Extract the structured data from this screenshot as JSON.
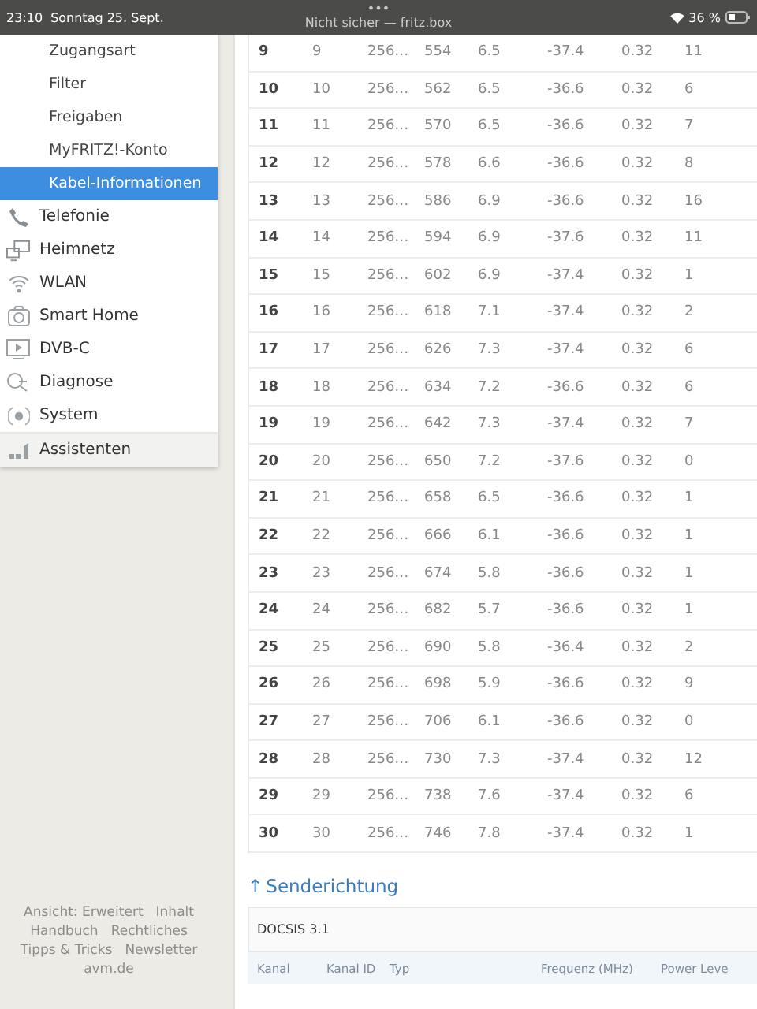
{
  "status_bar": {
    "time": "23:10",
    "date": "Sonntag 25. Sept.",
    "dots": "•••",
    "address": "Nicht sicher — fritz.box",
    "battery": "36 %"
  },
  "sidebar": {
    "items": [
      {
        "label": "Zugangsart",
        "kind": "sub",
        "selected": false
      },
      {
        "label": "Filter",
        "kind": "sub",
        "selected": false
      },
      {
        "label": "Freigaben",
        "kind": "sub",
        "selected": false
      },
      {
        "label": "MyFRITZ!-Konto",
        "kind": "sub",
        "selected": false
      },
      {
        "label": "Kabel-Informationen",
        "kind": "sub",
        "selected": true
      },
      {
        "label": "Telefonie",
        "kind": "main",
        "selected": false
      },
      {
        "label": "Heimnetz",
        "kind": "main",
        "selected": false
      },
      {
        "label": "WLAN",
        "kind": "main",
        "selected": false
      },
      {
        "label": "Smart Home",
        "kind": "main",
        "selected": false
      },
      {
        "label": "DVB-C",
        "kind": "main",
        "selected": false
      },
      {
        "label": "Diagnose",
        "kind": "main",
        "selected": false
      },
      {
        "label": "System",
        "kind": "main",
        "selected": false
      },
      {
        "label": "Assistenten",
        "kind": "assistant",
        "selected": false
      }
    ]
  },
  "footer_links": [
    [
      "Ansicht: Erweitert",
      "Inhalt"
    ],
    [
      "Handbuch",
      "Rechtliches"
    ],
    [
      "Tipps & Tricks",
      "Newsletter"
    ],
    [
      "avm.de"
    ]
  ],
  "table": {
    "rows": [
      [
        "9",
        "9",
        "256…",
        "554",
        "6.5",
        "-37.4",
        "0.32",
        "11"
      ],
      [
        "10",
        "10",
        "256…",
        "562",
        "6.5",
        "-36.6",
        "0.32",
        "6"
      ],
      [
        "11",
        "11",
        "256…",
        "570",
        "6.5",
        "-36.6",
        "0.32",
        "7"
      ],
      [
        "12",
        "12",
        "256…",
        "578",
        "6.6",
        "-36.6",
        "0.32",
        "8"
      ],
      [
        "13",
        "13",
        "256…",
        "586",
        "6.9",
        "-36.6",
        "0.32",
        "16"
      ],
      [
        "14",
        "14",
        "256…",
        "594",
        "6.9",
        "-37.6",
        "0.32",
        "11"
      ],
      [
        "15",
        "15",
        "256…",
        "602",
        "6.9",
        "-37.4",
        "0.32",
        "1"
      ],
      [
        "16",
        "16",
        "256…",
        "618",
        "7.1",
        "-37.4",
        "0.32",
        "2"
      ],
      [
        "17",
        "17",
        "256…",
        "626",
        "7.3",
        "-37.4",
        "0.32",
        "6"
      ],
      [
        "18",
        "18",
        "256…",
        "634",
        "7.2",
        "-36.6",
        "0.32",
        "6"
      ],
      [
        "19",
        "19",
        "256…",
        "642",
        "7.3",
        "-37.4",
        "0.32",
        "7"
      ],
      [
        "20",
        "20",
        "256…",
        "650",
        "7.2",
        "-37.6",
        "0.32",
        "0"
      ],
      [
        "21",
        "21",
        "256…",
        "658",
        "6.5",
        "-36.6",
        "0.32",
        "1"
      ],
      [
        "22",
        "22",
        "256…",
        "666",
        "6.1",
        "-36.6",
        "0.32",
        "1"
      ],
      [
        "23",
        "23",
        "256…",
        "674",
        "5.8",
        "-36.6",
        "0.32",
        "1"
      ],
      [
        "24",
        "24",
        "256…",
        "682",
        "5.7",
        "-36.6",
        "0.32",
        "1"
      ],
      [
        "25",
        "25",
        "256…",
        "690",
        "5.8",
        "-36.4",
        "0.32",
        "2"
      ],
      [
        "26",
        "26",
        "256…",
        "698",
        "5.9",
        "-36.6",
        "0.32",
        "9"
      ],
      [
        "27",
        "27",
        "256…",
        "706",
        "6.1",
        "-36.6",
        "0.32",
        "0"
      ],
      [
        "28",
        "28",
        "256…",
        "730",
        "7.3",
        "-37.4",
        "0.32",
        "12"
      ],
      [
        "29",
        "29",
        "256…",
        "738",
        "7.6",
        "-37.4",
        "0.32",
        "6"
      ],
      [
        "30",
        "30",
        "256…",
        "746",
        "7.8",
        "-37.4",
        "0.32",
        "1"
      ]
    ]
  },
  "upstream": {
    "arrow": "↑",
    "title": "Senderichtung",
    "section": "DOCSIS 3.1",
    "columns": [
      "Kanal",
      "Kanal ID",
      "Typ",
      "Frequenz (MHz)",
      "Power Leve"
    ]
  }
}
